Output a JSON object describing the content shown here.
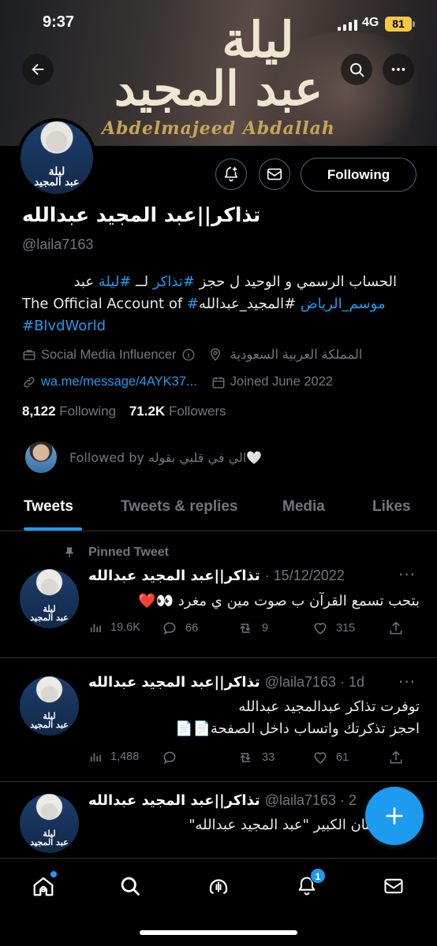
{
  "status_bar": {
    "time": "9:37",
    "network": "4G",
    "battery": "81"
  },
  "banner": {
    "title_line1": "ليلة",
    "title_line2": "عبد المجيد",
    "subtitle": "Abdelmajeed Abdallah",
    "avatar_line1": "ليلة",
    "avatar_line2": "عبد المجيد"
  },
  "profile": {
    "follow_button": "Following",
    "name": "تذاكر||عبد المجيد عبدالله",
    "handle": "@laila7163",
    "bio": {
      "line1_text": "الحساب الرسمي و الوحيد ل حجز ",
      "line1_link1": "#تذاكر",
      "line1_mid": " لــ ",
      "line1_link2": "#ليلة",
      "line1_end": " عبد",
      "line2_prefix": "The Official Account of ",
      "line2_link": "#موسم_الرياض",
      "line2_text": " #المجيد_عبدالله",
      "line3_link": "#BlvdWorld"
    },
    "category": "Social Media Influencer",
    "location": "المملكة العربية السعودية",
    "website": "wa.me/message/4AYK37...",
    "joined": "Joined June 2022",
    "following_count": "8,122",
    "following_label": "Following",
    "followers_count": "71.2K",
    "followers_label": "Followers",
    "followed_by": "Followed by الي في قلبي بقوله🤍"
  },
  "tabs": [
    {
      "label": "Tweets"
    },
    {
      "label": "Tweets & replies"
    },
    {
      "label": "Media"
    },
    {
      "label": "Likes"
    }
  ],
  "tweets": [
    {
      "pinned_label": "Pinned Tweet",
      "name": "تذاكر||عبد المجيد عبدالله",
      "meta": "· 15/12/2022",
      "text": "بتحب تسمع القرآن ب صوت مين ي مغرد 👀❤️",
      "views": "19.6K",
      "replies": "66",
      "retweets": "9",
      "likes": "315"
    },
    {
      "name": "تذاكر||عبد المجيد عبدالله",
      "meta": "@laila7163 · 1d",
      "text_line1": "توفرت تذاكر عبدالمجيد عبدالله",
      "text_line2": "احجز تذكرتك واتساب داخل الصفحة📄📄",
      "views": "1,488",
      "replies": "",
      "retweets": "33",
      "likes": "61"
    },
    {
      "name": "تذاكر||عبد المجيد عبدالله",
      "meta": "@laila7163 · 2",
      "text": "تذاكر الفنان الكبير \"عبد المجيد عبدالله\""
    }
  ],
  "bottom_nav": {
    "notification_badge": "1"
  },
  "colors": {
    "accent": "#1d9bf0",
    "background": "#000000",
    "muted": "#71767b",
    "battery": "#f6c744"
  }
}
